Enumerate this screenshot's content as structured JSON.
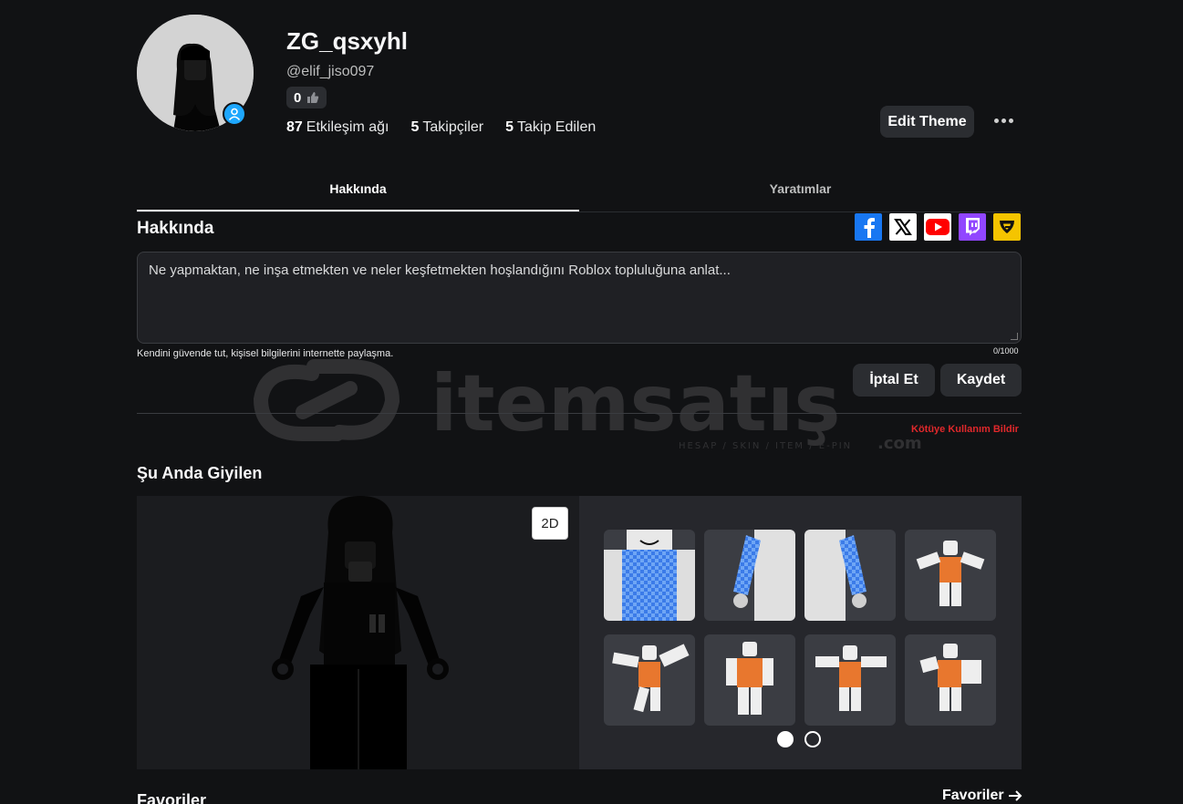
{
  "profile": {
    "display_name": "ZG_qsxyhl",
    "username": "@elif_jiso097",
    "likes": "0",
    "stats": [
      {
        "value": "87",
        "label": "Etkileşim ağı"
      },
      {
        "value": "5",
        "label": "Takipçiler"
      },
      {
        "value": "5",
        "label": "Takip Edilen"
      }
    ],
    "edit_theme": "Edit Theme"
  },
  "tabs": [
    {
      "label": "Hakkında",
      "active": true
    },
    {
      "label": "Yaratımlar",
      "active": false
    }
  ],
  "about": {
    "heading": "Hakkında",
    "placeholder": "Ne yapmaktan, ne inşa etmekten ve neler keşfetmekten hoşlandığını Roblox topluluğuna anlat...",
    "safety_note": "Kendini güvende tut, kişisel bilgilerini internette paylaşma.",
    "counter": "0/1000",
    "cancel": "İptal Et",
    "save": "Kaydet",
    "report": "Kötüye Kullanım Bildir",
    "socials": [
      {
        "icon": "facebook-icon",
        "color": "#1877f2"
      },
      {
        "icon": "x-icon",
        "color": "#ffffff"
      },
      {
        "icon": "youtube-icon",
        "color": "#ff0000"
      },
      {
        "icon": "twitch-icon",
        "color": "#9146ff"
      },
      {
        "icon": "guilded-icon",
        "color": "#f5c400"
      }
    ]
  },
  "watermark": {
    "brand": "itemsatış",
    "suffix": ".com",
    "tagline": "HESAP / SKIN / ITEM / E-PIN"
  },
  "wearing": {
    "heading": "Şu Anda Giyilen",
    "toggle_2d": "2D",
    "items": [
      {
        "name": "checkered-shirt-front"
      },
      {
        "name": "checkered-sleeve-left"
      },
      {
        "name": "checkered-sleeve-right"
      },
      {
        "name": "emote-1"
      },
      {
        "name": "emote-2"
      },
      {
        "name": "emote-3"
      },
      {
        "name": "emote-4"
      },
      {
        "name": "emote-5"
      }
    ],
    "pages": 2,
    "current_page": 1
  },
  "favorites": {
    "heading": "Favoriler",
    "link": "Favoriler"
  },
  "colors": {
    "background": "#111214",
    "accent_verified": "#1ea7fd",
    "report_red": "#e0282b"
  }
}
